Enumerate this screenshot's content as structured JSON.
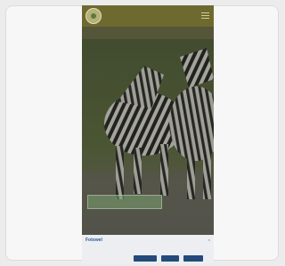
{
  "nav": {
    "items": [
      "",
      "",
      "",
      "",
      ""
    ]
  },
  "hero": {
    "cta_label": ""
  },
  "cookie_banner": {
    "title": "Fotowel",
    "close_label": "×",
    "heading": "",
    "text": "",
    "buttons": [
      "",
      "",
      ""
    ]
  },
  "colors": {
    "topbar": "#6e6a2f",
    "navbar": "#55553a",
    "cookie_title": "#2d5a9a",
    "cookie_button": "#234a7b"
  },
  "icons": [
    "logo-icon",
    "menu-icon",
    "close-icon"
  ]
}
